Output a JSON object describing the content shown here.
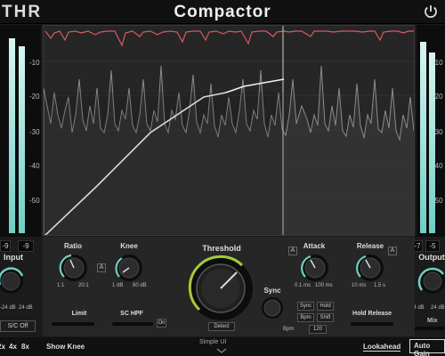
{
  "header": {
    "brand": "THR",
    "title": "Compactor"
  },
  "input_meter": {
    "scale": [
      "-10",
      "-20",
      "-30",
      "-40",
      "-50"
    ],
    "levels": [
      0.97,
      0.93
    ],
    "peak_left": "-9",
    "peak_right": "-9",
    "label": "Input",
    "min": "-24 dB",
    "max": "24 dB"
  },
  "output_meter": {
    "scale": [
      "-10",
      "-20",
      "-30",
      "-40",
      "-50"
    ],
    "levels": [
      0.95,
      0.9
    ],
    "peak_left": "-7",
    "peak_right": "-5",
    "label": "Output",
    "min": "-24 dB",
    "max": "24 dB"
  },
  "controls": {
    "ratio": {
      "label": "Ratio",
      "min": "1:1",
      "max": "20:1"
    },
    "knee": {
      "label": "Knee",
      "min": "1 dB",
      "max": "60 dB"
    },
    "threshold": {
      "label": "Threshold",
      "detect": "Detect"
    },
    "sync": {
      "label": "Sync",
      "options": [
        "Sync",
        "Hold",
        "Bpm",
        "Shift"
      ],
      "bpm_label": "Bpm",
      "bpm_value": "120"
    },
    "attack": {
      "label": "Attack",
      "min": "0.1 ms",
      "max": "100 ms"
    },
    "release": {
      "label": "Release",
      "min": "10 ms",
      "max": "1.5 s"
    },
    "auto_btn": "A",
    "limit": "Limit",
    "sc_hpf": "SC HPF",
    "sc_on": "On",
    "hold_release": "Hold Release",
    "sc_off": "S/C Off",
    "mix": "Mix"
  },
  "bottom": {
    "zoom": [
      "2x",
      "4x",
      "8x"
    ],
    "show_knee": "Show Knee",
    "ui_size": "Simple UI",
    "lookahead": "Lookahead",
    "auto_gain": "Auto Gain"
  },
  "colors": {
    "accent_teal": "#6fcfc5",
    "gain_red": "#d9595f",
    "threshold_green": "#a6c93a"
  }
}
